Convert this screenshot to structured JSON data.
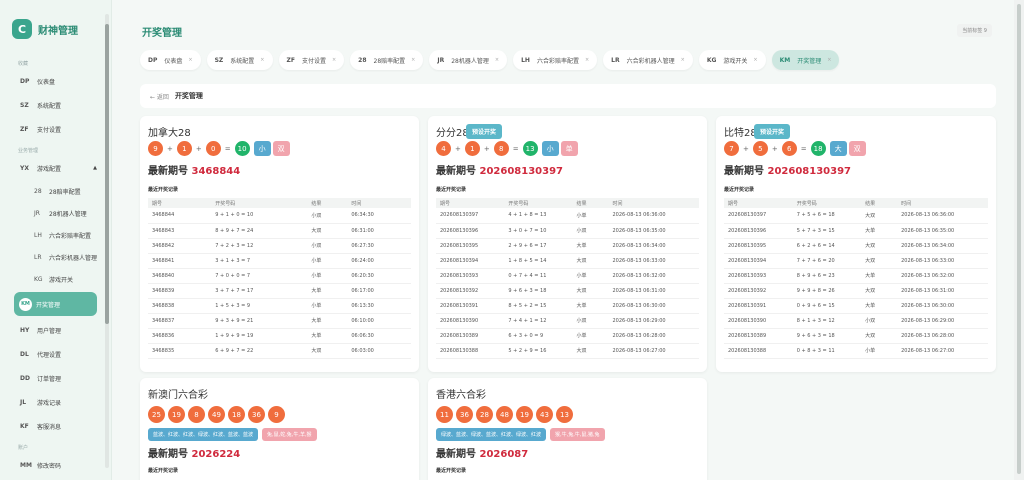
{
  "sidebar": {
    "brand": {
      "logo": "C",
      "title": "财神管理"
    },
    "group_favorites": "收藏",
    "group_business": "业务管理",
    "group_account": "账户",
    "fav_items": [
      {
        "code": "DP",
        "label": "仪表盘"
      },
      {
        "code": "SZ",
        "label": "系统配置"
      },
      {
        "code": "ZF",
        "label": "支付设置"
      }
    ],
    "game": {
      "code": "YX",
      "label": "游戏配置",
      "caret": "▲"
    },
    "game_subs": [
      {
        "code": "28",
        "label": "28赔率配置"
      },
      {
        "code": "JR",
        "label": "28机器人管理"
      },
      {
        "code": "LH",
        "label": "六合彩赔率配置"
      },
      {
        "code": "LR",
        "label": "六合彩机器人管理"
      },
      {
        "code": "KG",
        "label": "游戏开关"
      }
    ],
    "active": {
      "code": "KM",
      "label": "开奖管理"
    },
    "more_items": [
      {
        "code": "HY",
        "label": "用户管理"
      },
      {
        "code": "DL",
        "label": "代理设置"
      },
      {
        "code": "DD",
        "label": "订单管理"
      },
      {
        "code": "JL",
        "label": "游戏记录"
      },
      {
        "code": "KF",
        "label": "客服消息"
      }
    ],
    "account_items": [
      {
        "code": "MM",
        "label": "修改密码"
      }
    ]
  },
  "header": {
    "title": "开奖管理",
    "badge": "当前标签 9"
  },
  "tabs": [
    {
      "code": "DP",
      "label": "仪表盘"
    },
    {
      "code": "SZ",
      "label": "系统配置"
    },
    {
      "code": "ZF",
      "label": "支付设置"
    },
    {
      "code": "28",
      "label": "28赔率配置"
    },
    {
      "code": "JR",
      "label": "28机器人管理"
    },
    {
      "code": "LH",
      "label": "六合彩赔率配置"
    },
    {
      "code": "LR",
      "label": "六合彩机器人管理"
    },
    {
      "code": "KG",
      "label": "游戏开关"
    },
    {
      "code": "KM",
      "label": "开奖管理"
    }
  ],
  "tab_close": "×",
  "breadcrumb": {
    "back": "← 返回",
    "title": "开奖管理"
  },
  "labels": {
    "latest": "最新期号",
    "records": "最近开奖记录",
    "preset": "预设开奖",
    "plus": "+",
    "eq": "="
  },
  "cols_short": [
    "期号",
    "开奖号码",
    "结果",
    "时间"
  ],
  "cards": [
    {
      "name": "加拿大28",
      "balls": [
        "9",
        "1",
        "0"
      ],
      "sum": "10",
      "size": "小",
      "parity": "双",
      "issue": "3468844",
      "has_preset": false,
      "rows": [
        [
          "3468844",
          "9 + 1 + 0 = 10",
          "小双",
          "06:34:30"
        ],
        [
          "3468843",
          "8 + 9 + 7 = 24",
          "大双",
          "06:31:00"
        ],
        [
          "3468842",
          "7 + 2 + 3 = 12",
          "小双",
          "06:27:30"
        ],
        [
          "3468841",
          "3 + 1 + 3 = 7",
          "小单",
          "06:24:00"
        ],
        [
          "3468840",
          "7 + 0 + 0 = 7",
          "小单",
          "06:20:30"
        ],
        [
          "3468839",
          "3 + 7 + 7 = 17",
          "大单",
          "06:17:00"
        ],
        [
          "3468838",
          "1 + 5 + 3 = 9",
          "小单",
          "06:13:30"
        ],
        [
          "3468837",
          "9 + 3 + 9 = 21",
          "大单",
          "06:10:00"
        ],
        [
          "3468836",
          "1 + 9 + 9 = 19",
          "大单",
          "06:06:30"
        ],
        [
          "3468835",
          "6 + 9 + 7 = 22",
          "大双",
          "06:03:00"
        ]
      ]
    },
    {
      "name": "分分28",
      "balls": [
        "4",
        "1",
        "8"
      ],
      "sum": "13",
      "size": "小",
      "parity": "单",
      "issue": "202608130397",
      "has_preset": true,
      "rows": [
        [
          "202608130397",
          "4 + 1 + 8 = 13",
          "小单",
          "2026-08-13 06:36:00"
        ],
        [
          "202608130396",
          "3 + 0 + 7 = 10",
          "小双",
          "2026-08-13 06:35:00"
        ],
        [
          "202608130395",
          "2 + 9 + 6 = 17",
          "大单",
          "2026-08-13 06:34:00"
        ],
        [
          "202608130394",
          "1 + 8 + 5 = 14",
          "大双",
          "2026-08-13 06:33:00"
        ],
        [
          "202608130393",
          "0 + 7 + 4 = 11",
          "小单",
          "2026-08-13 06:32:00"
        ],
        [
          "202608130392",
          "9 + 6 + 3 = 18",
          "大双",
          "2026-08-13 06:31:00"
        ],
        [
          "202608130391",
          "8 + 5 + 2 = 15",
          "大单",
          "2026-08-13 06:30:00"
        ],
        [
          "202608130390",
          "7 + 4 + 1 = 12",
          "小双",
          "2026-08-13 06:29:00"
        ],
        [
          "202608130389",
          "6 + 3 + 0 = 9",
          "小单",
          "2026-08-13 06:28:00"
        ],
        [
          "202608130388",
          "5 + 2 + 9 = 16",
          "大双",
          "2026-08-13 06:27:00"
        ]
      ]
    },
    {
      "name": "比特28",
      "balls": [
        "7",
        "5",
        "6"
      ],
      "sum": "18",
      "size": "大",
      "parity": "双",
      "issue": "202608130397",
      "has_preset": true,
      "rows": [
        [
          "202608130397",
          "7 + 5 + 6 = 18",
          "大双",
          "2026-08-13 06:36:00"
        ],
        [
          "202608130396",
          "5 + 7 + 3 = 15",
          "大单",
          "2026-08-13 06:35:00"
        ],
        [
          "202608130395",
          "6 + 2 + 6 = 14",
          "大双",
          "2026-08-13 06:34:00"
        ],
        [
          "202608130394",
          "7 + 7 + 6 = 20",
          "大双",
          "2026-08-13 06:33:00"
        ],
        [
          "202608130393",
          "8 + 9 + 6 = 23",
          "大单",
          "2026-08-13 06:32:00"
        ],
        [
          "202608130392",
          "9 + 9 + 8 = 26",
          "大双",
          "2026-08-13 06:31:00"
        ],
        [
          "202608130391",
          "0 + 9 + 6 = 15",
          "大单",
          "2026-08-13 06:30:00"
        ],
        [
          "202608130390",
          "8 + 1 + 3 = 12",
          "小双",
          "2026-08-13 06:29:00"
        ],
        [
          "202608130389",
          "9 + 6 + 3 = 18",
          "大双",
          "2026-08-13 06:28:00"
        ],
        [
          "202608130388",
          "0 + 8 + 3 = 11",
          "小单",
          "2026-08-13 06:27:00"
        ]
      ]
    }
  ],
  "lhc": [
    {
      "name": "新澳门六合彩",
      "balls": [
        "25",
        "19",
        "8",
        "49",
        "18",
        "36",
        "9"
      ],
      "attrs": "蓝波、红波、红波、绿波、红波、蓝波、蓝波",
      "zodiac": "兔,鼠,蛇,兔,牛,羊,猴",
      "issue": "2026224"
    },
    {
      "name": "香港六合彩",
      "balls": [
        "11",
        "36",
        "28",
        "48",
        "19",
        "43",
        "13"
      ],
      "attrs": "绿波、蓝波、绿波、蓝波、红波、绿波、红波",
      "zodiac": "猴,牛,兔,牛,鼠,猪,兔",
      "issue": "2026087"
    }
  ],
  "colors": {
    "accent": "#3aa58d",
    "issue_red": "#d02a3d",
    "ball_orange": "#f06d3d",
    "ball_green": "#21b46a",
    "tag_blue": "#58a9cf",
    "tag_pink": "#f1a4ad"
  }
}
